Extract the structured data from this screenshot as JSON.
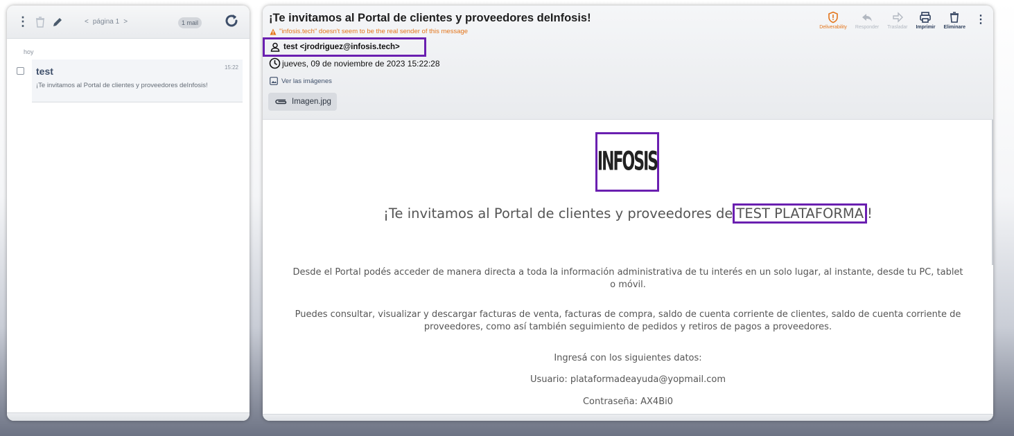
{
  "list": {
    "pager_prev": "<",
    "pager_label": "página 1",
    "pager_next": ">",
    "count_badge": "1 mail",
    "day_label": "hoy",
    "items": [
      {
        "sender": "test",
        "time": "15:22",
        "preview": "¡Te invitamos al Portal de clientes y proveedores deInfosis!"
      }
    ]
  },
  "message": {
    "subject": "¡Te invitamos al Portal de clientes y proveedores deInfosis!",
    "warning": "\"infosis.tech\" doesn't seem to be the real sender of this message",
    "from": "test <jrodriguez@infosis.tech>",
    "date": "jueves, 09 de noviembre de 2023 15:22:28",
    "view_images": "Ver las imágenes",
    "attachment": "Imagen.jpg",
    "toolbar": {
      "deliverability": "Deliverability",
      "reply": "Responder",
      "move": "Trasladar",
      "print": "Imprimir",
      "delete": "Eliminare"
    }
  },
  "body": {
    "logo_text": "INFOSIS",
    "headline_prefix": "¡Te invitamos al Portal de clientes y proveedores de",
    "headline_brand": "TEST PLATAFORMA",
    "headline_suffix": "!",
    "paragraph1": "Desde el Portal podés acceder de manera directa a toda la información administrativa de tu interés en un solo lugar, al instante, desde tu PC, tablet o móvil.",
    "paragraph2": "Puedes consultar, visualizar y descargar facturas de venta, facturas de compra, saldo de cuenta corriente de clientes, saldo de cuenta corriente de proveedores, como así también seguimiento de pedidos y retiros de pagos a proveedores.",
    "paragraph3": "Ingresá con los siguientes datos:",
    "user_line": "Usuario: plataformadeayuda@yopmail.com",
    "password_line": "Contraseña: AX4Bi0"
  },
  "colors": {
    "highlight_box": "#6a1fb0",
    "warning": "#e3751b",
    "accent": "#2e3f5c"
  }
}
